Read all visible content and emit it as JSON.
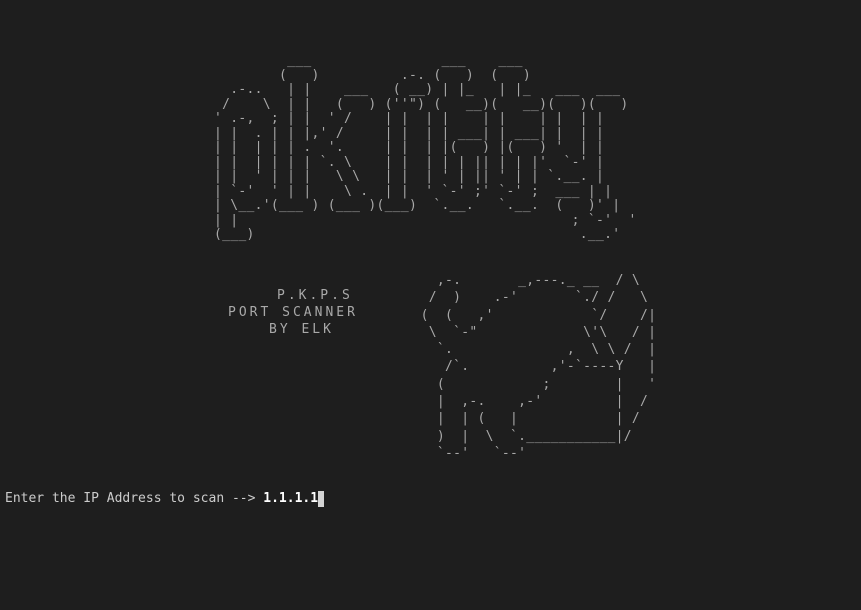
{
  "banner_art": "         ___                ___    ___\n        (   )          .-. (   )  (   )\n  .-..   | |    ___   ( __) | |_   | |_   ___  ___\n /    \\  | |   (   ) (''\") (   __)(   __)(   )(   )\n' .-,  ; | |  ' /    | |  | |    | |    | |  | |\n| |  . | | |,' /     | |  | | ___| | ___| |  | |\n| |  | | | .  '.     | |  | |(   ) |(   ) '  | |\n| |  | | | | `. \\    | |  | | | || | | |'  `-' |\n| |  ' | | |   \\ \\   | |  | ' | || ' | | `.__. |\n| `-'  ' | |    \\ .  | |  ' `-' ;' `-' ;  ___ | |\n| \\__.'(___ ) (___ )(___)  `.__.   `.__.  (   )' |\n| |                                         ; `-'  '\n(___)                                        .__.'",
  "cat_art": "       ,-.       _,---._ __  / \\\n      /  )    .-'       `./ /   \\\n     (  (   ,'            `/    /|\n      \\  `-\"             \\'\\   / |\n       `.              ,  \\ \\ /  |\n        /`.          ,'-`----Y   |\n       (            ;        |   '\n       |  ,-.    ,-'         |  /\n       |  | (   |            | /\n       )  |  \\  `.___________|/\n       `--'   `--'",
  "info": {
    "title": "P.K.P.S",
    "subtitle": "PORT SCANNER",
    "author": "BY ELK"
  },
  "prompt": {
    "label": "Enter the IP Address to scan --> ",
    "value": "1.1.1.1"
  }
}
